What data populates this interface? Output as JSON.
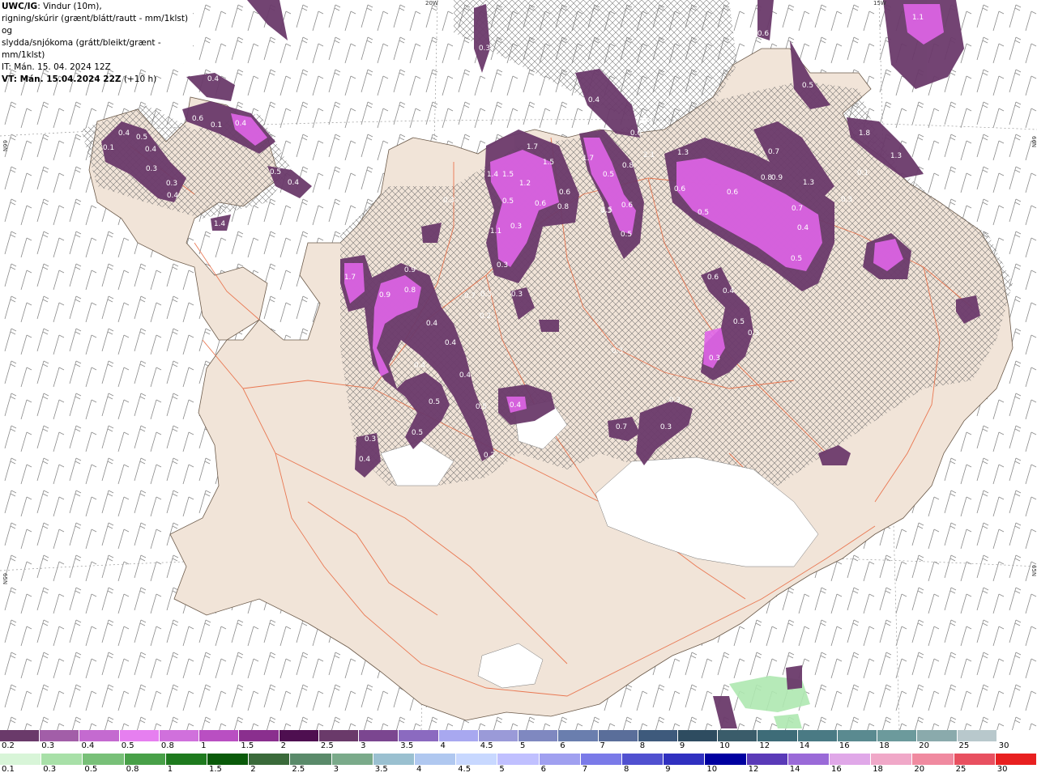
{
  "header": {
    "model": "UWC/IG",
    "line1_rest": ": Vindur (10m),",
    "line2": "rigning/skúrir (grænt/blátt/rautt - mm/1klst) og",
    "line3": "slydda/snjókoma (grátt/bleikt/grænt - mm/1klst)",
    "line4": "IT: Mán. 15. 04. 2024 12Z",
    "line5_bold": "VT: Mán. 15.04.2024 22Z",
    "line5_rest": " (+10 h)"
  },
  "map_edge_labels": {
    "top_left": "20W",
    "top_right": "15W",
    "left_top": "66N",
    "left_bottom": "65N",
    "right_top": "66N",
    "right_bottom": "65N"
  },
  "precip_values": [
    "1.1",
    "0.6",
    "0.3",
    "0.5",
    "0.4",
    "0.4",
    "0.6",
    "0.1",
    "0.4",
    "0.5",
    "0.4",
    "0.1",
    "0.4",
    "0.3",
    "0.3",
    "0.4",
    "0.5",
    "0.4",
    "1.4",
    "1.7",
    "1.5",
    "1.7",
    "1.4",
    "1.5",
    "1.2",
    "0.5",
    "0.8",
    "0.6",
    "2.1",
    "1.3",
    "0.6",
    "0.6",
    "0.5",
    "0.6",
    "0.7",
    "0.8",
    "0.9",
    "1.3",
    "0.8",
    "0.6",
    "0.5",
    "1.5",
    "0.6",
    "0.5",
    "0.3",
    "1.8",
    "1.3",
    "1.1",
    "0.3",
    "0.3",
    "0.3",
    "0.3",
    "0.1",
    "1.7",
    "0.9",
    "0.8",
    "0.9",
    "0.4",
    "0.4",
    "0.4",
    "0.4",
    "0.5",
    "0.5",
    "0.3",
    "0.6",
    "0.4",
    "0.5",
    "0.3",
    "0.7",
    "0.4",
    "0.5",
    "0.5",
    "0.3",
    "0.4",
    "0.2",
    "0.4",
    "0.7",
    "0.3",
    "0.3",
    "0.3",
    "0.3",
    "0.7",
    "0.2",
    "0.3"
  ],
  "colors": {
    "land": "#f1e4d8",
    "hatch": "#555555",
    "roads": "#e8643a",
    "precip_dark": "#6b3a6b",
    "precip_mid": "#9a4aa0",
    "precip_bright": "#e065e8",
    "rain_green": "#aee8b0"
  },
  "legend_snow": {
    "labels": [
      "0.2",
      "0.3",
      "0.4",
      "0.5",
      "0.8",
      "1",
      "1.5",
      "2",
      "2.5",
      "3",
      "3.5",
      "4",
      "4.5",
      "5",
      "6",
      "7",
      "8",
      "9",
      "10",
      "12",
      "14",
      "16",
      "18",
      "20",
      "25",
      "30"
    ],
    "colors": [
      "#6a3a6a",
      "#a25ea8",
      "#c46ad0",
      "#e67ff0",
      "#d070dc",
      "#b94fc2",
      "#8a2f8e",
      "#4e0f50",
      "#6a3a6a",
      "#7b4690",
      "#8b6ac0",
      "#a8a8f0",
      "#9a9ad8",
      "#7f88c0",
      "#6a7eae",
      "#5a6e9a",
      "#3e5a7c",
      "#2e4c60",
      "#3a5c6a",
      "#3e6c78",
      "#4a7a84",
      "#5a8a90",
      "#6c9a9c",
      "#8aaaac",
      "#b8c8cc",
      "#ffffff"
    ]
  },
  "legend_rain": {
    "labels": [
      "0.1",
      "0.3",
      "0.5",
      "0.8",
      "1",
      "1.5",
      "2",
      "2.5",
      "3",
      "3.5",
      "4",
      "4.5",
      "5",
      "6",
      "7",
      "8",
      "9",
      "10",
      "12",
      "14",
      "16",
      "18",
      "20",
      "25",
      "30"
    ],
    "colors": [
      "#d8f5d8",
      "#a8e0a8",
      "#78c078",
      "#48a048",
      "#1e7a1e",
      "#0a5a0a",
      "#3a6a3a",
      "#5a8a6a",
      "#7aaa8a",
      "#9ac0d0",
      "#b0c8f0",
      "#c8d8ff",
      "#c0c0ff",
      "#a0a0f0",
      "#7a7ae8",
      "#5050d0",
      "#3030c0",
      "#0000a0",
      "#5a3ab8",
      "#9a6ad8",
      "#e0a8e8",
      "#f0a8c8",
      "#f08aa0",
      "#e85060",
      "#e82020"
    ]
  }
}
